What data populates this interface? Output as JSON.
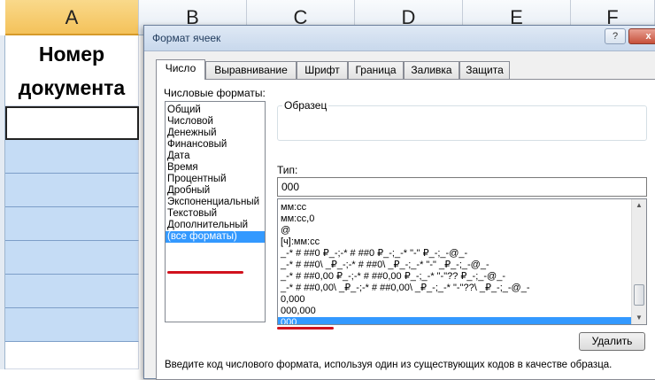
{
  "sheet": {
    "columns": [
      "A",
      "B",
      "C",
      "D",
      "E",
      "F"
    ],
    "header_cell_line1": "Номер",
    "header_cell_line2": "документа"
  },
  "dialog": {
    "title": "Формат ячеек",
    "help_label": "?",
    "close_label": "x",
    "tabs": [
      "Число",
      "Выравнивание",
      "Шрифт",
      "Граница",
      "Заливка",
      "Защита"
    ],
    "active_tab": "Число",
    "numeric_formats_label": "Числовые форматы:",
    "categories": [
      "Общий",
      "Числовой",
      "Денежный",
      "Финансовый",
      "Дата",
      "Время",
      "Процентный",
      "Дробный",
      "Экспоненциальный",
      "Текстовый",
      "Дополнительный",
      "(все форматы)"
    ],
    "selected_category": "(все форматы)",
    "sample_label": "Образец",
    "type_label": "Тип:",
    "type_value": "000",
    "format_codes": [
      "мм:сс",
      "мм:сс,0",
      "@",
      "[ч]:мм:сс",
      "_-* # ##0 ₽_-;-* # ##0 ₽_-;_-* \"-\" ₽_-;_-@_-",
      "_-* # ##0\\ _₽_-;-* # ##0\\ _₽_-;_-* \"-\" _₽_-;_-@_-",
      "_-* # ##0,00 ₽_-;-* # ##0,00 ₽_-;_-* \"-\"?? ₽_-;_-@_-",
      "_-* # ##0,00\\ _₽_-;-* # ##0,00\\ _₽_-;_-* \"-\"??\\ _₽_-;_-@_-",
      "0,000",
      "000,000",
      "000"
    ],
    "selected_format": "000",
    "delete_label": "Удалить",
    "hint": "Введите код числового формата, используя один из существующих кодов в качестве образца.",
    "accent_color": "#3399ff",
    "annotation_color": "#d1121d"
  }
}
